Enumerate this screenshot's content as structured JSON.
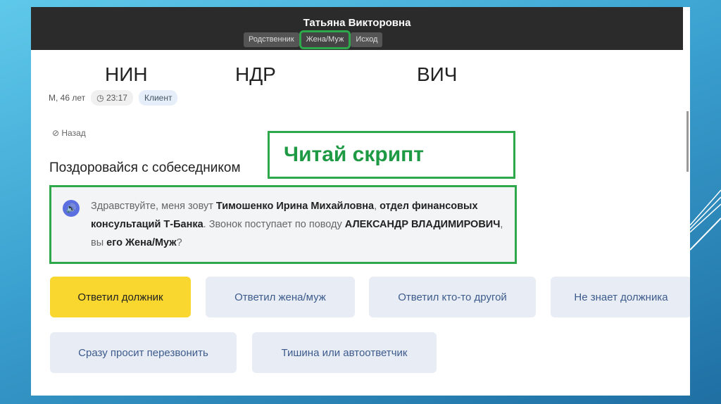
{
  "header": {
    "name": "Татьяна Викторовна",
    "tabs": [
      "Родственник",
      "Жена/Муж",
      "Исход"
    ]
  },
  "labels": {
    "nin": "НИН",
    "ndr": "НДР",
    "vich": "ВИЧ"
  },
  "meta": {
    "person": "М, 46 лет",
    "time": "23:17",
    "role": "Клиент"
  },
  "back": "Назад",
  "step_title": "Поздоровайся с собеседником",
  "annotation": "Читай скрипт",
  "script": {
    "p1": "Здравствуйте, меня зовут ",
    "b1": "Тимошенко Ирина Михайловна",
    "p2": ", ",
    "b2": "отдел финансовых консультаций Т-Банка",
    "p3": ". Звонок поступает по поводу ",
    "b3": "АЛЕКСАНДР ВЛАДИМИРОВИЧ",
    "p4": ", вы ",
    "b4": "его Жена/Муж",
    "p5": "?"
  },
  "buttons": [
    "Ответил должник",
    "Ответил жена/муж",
    "Ответил кто-то другой",
    "Не знает должника",
    "Сразу просит перезвонить",
    "Тишина или автоответчик"
  ]
}
